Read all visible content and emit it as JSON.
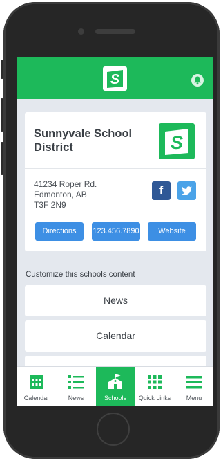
{
  "colors": {
    "brand_green": "#1db95a",
    "button_blue": "#3d8fe4",
    "facebook": "#2f5896",
    "twitter": "#4ba3e8"
  },
  "header": {
    "logo_icon": "school-s-logo",
    "notification_icon": "bell-icon"
  },
  "school": {
    "name": "Sunnyvale School District",
    "address_line1": "41234 Roper Rd.",
    "address_line2": "Edmonton, AB",
    "address_line3": "T3F 2N9",
    "facebook_label": "f",
    "twitter_icon": "twitter-bird-icon",
    "buttons": {
      "directions": "Directions",
      "phone": "123.456.7890",
      "website": "Website"
    }
  },
  "customize": {
    "heading": "Customize this schools content",
    "options": [
      "News",
      "Calendar"
    ]
  },
  "tabs": [
    {
      "label": "Calendar",
      "icon": "calendar-icon"
    },
    {
      "label": "News",
      "icon": "list-icon"
    },
    {
      "label": "Schools",
      "icon": "school-icon",
      "active": true
    },
    {
      "label": "Quick Links",
      "icon": "grid-icon"
    },
    {
      "label": "Menu",
      "icon": "hamburger-icon"
    }
  ]
}
